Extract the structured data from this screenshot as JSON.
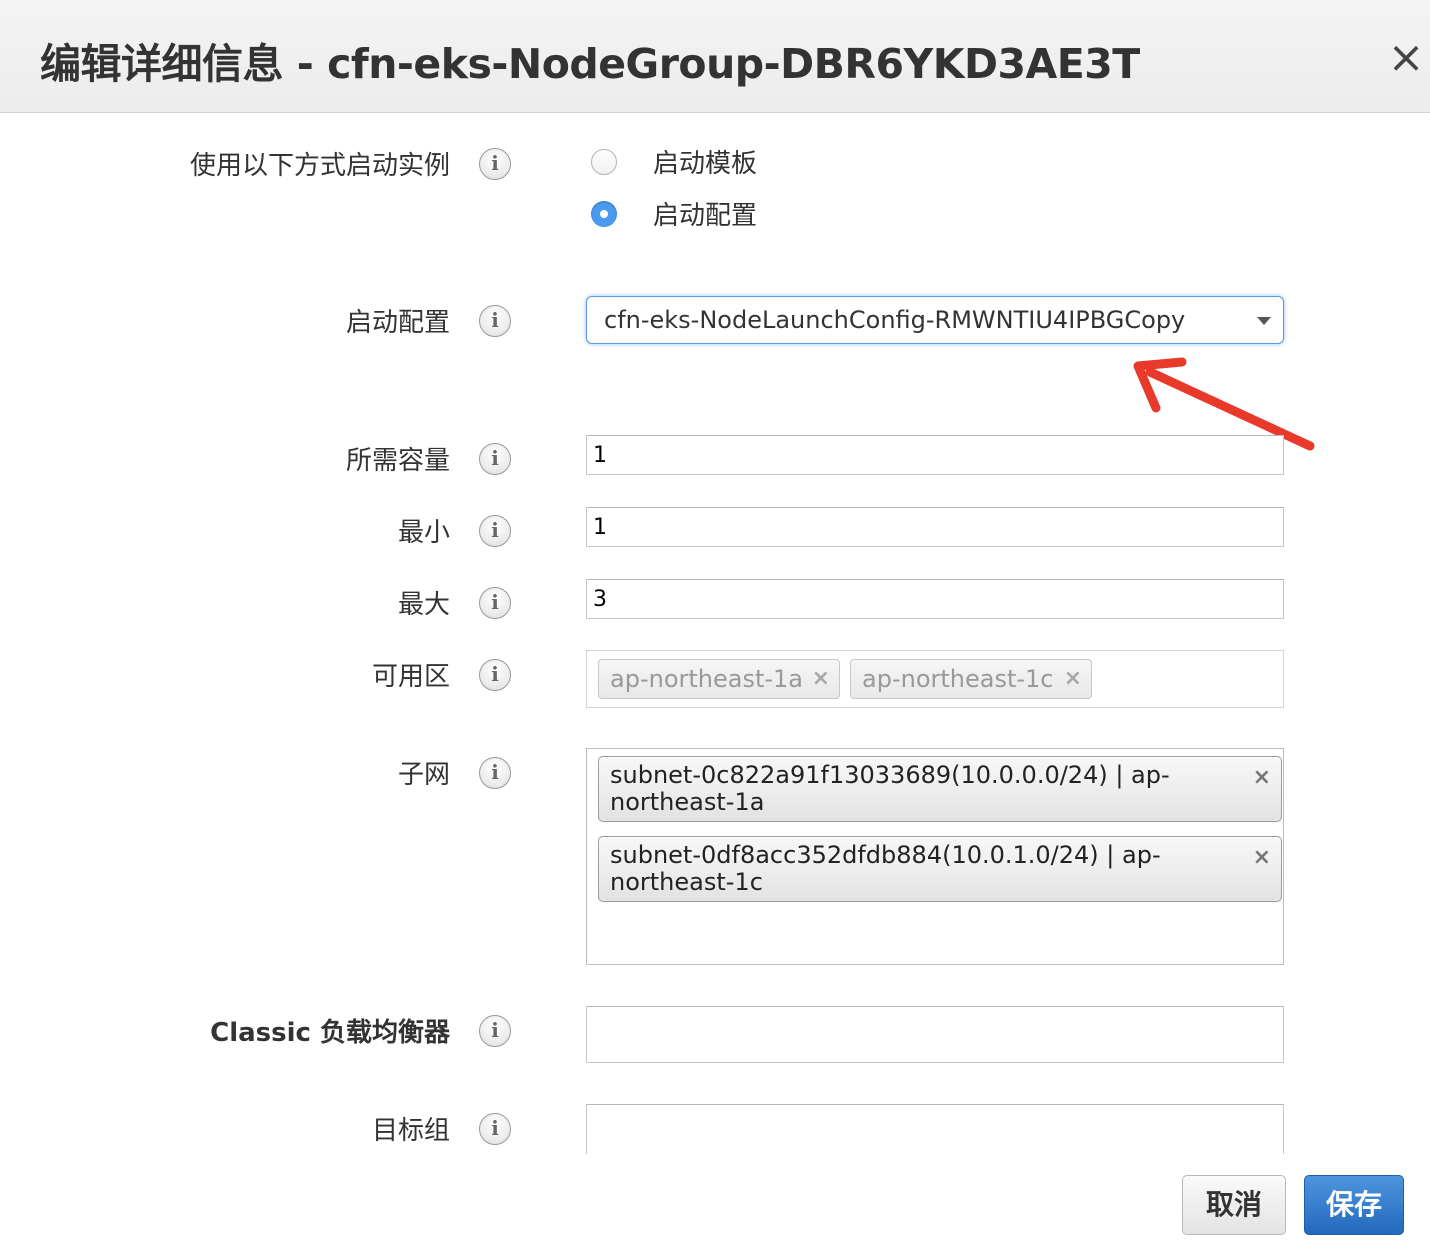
{
  "dialog": {
    "title": "编辑详细信息 - cfn-eks-NodeGroup-DBR6YKD3AE3T",
    "close_label": "×"
  },
  "fields": {
    "launch_method": {
      "label": "使用以下方式启动实例",
      "options": [
        "启动模板",
        "启动配置"
      ],
      "selected": "启动配置"
    },
    "launch_config": {
      "label": "启动配置",
      "value": "cfn-eks-NodeLaunchConfig-RMWNTIU4IPBGCopy"
    },
    "desired_capacity": {
      "label": "所需容量",
      "value": "1"
    },
    "min": {
      "label": "最小",
      "value": "1"
    },
    "max": {
      "label": "最大",
      "value": "3"
    },
    "availability_zones": {
      "label": "可用区",
      "chips": [
        "ap-northeast-1a",
        "ap-northeast-1c"
      ]
    },
    "subnets": {
      "label": "子网",
      "chips": [
        "subnet-0c822a91f13033689(10.0.0.0/24) | ap-northeast-1a",
        "subnet-0df8acc352dfdb884(10.0.1.0/24) | ap-northeast-1c"
      ]
    },
    "classic_lb": {
      "label": "Classic 负载均衡器",
      "value": ""
    },
    "target_group": {
      "label": "目标组",
      "value": ""
    }
  },
  "info_icon": "i",
  "chip_remove": "×",
  "buttons": {
    "cancel": "取消",
    "save": "保存"
  },
  "colors": {
    "primary": "#2f78c8",
    "annotation_arrow": "#e8392a",
    "focus": "#5a9ae0"
  }
}
